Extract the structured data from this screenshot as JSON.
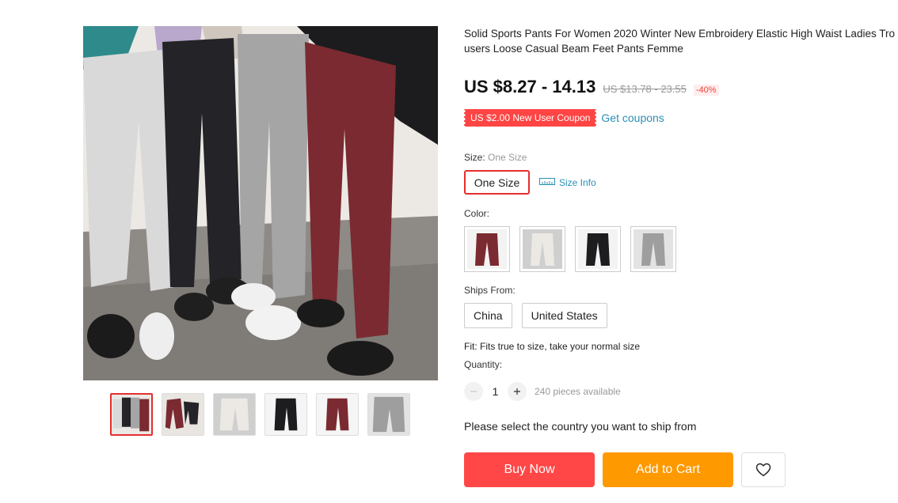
{
  "product": {
    "title": "Solid Sports Pants For Women 2020 Winter New Embroidery Elastic High Waist Ladies Trousers Loose Casual Beam Feet Pants Femme",
    "price": "US $8.27 - 14.13",
    "original_price": "US $13.78 - 23.55",
    "discount": "-40%"
  },
  "coupon": {
    "label": "US $2.00 New User Coupon",
    "link": "Get coupons"
  },
  "size": {
    "label": "Size:",
    "selected": "One Size",
    "option": "One Size",
    "info_link": "Size Info"
  },
  "color": {
    "label": "Color:",
    "swatches": [
      {
        "name": "burgundy",
        "color": "#7a2a30"
      },
      {
        "name": "white",
        "color": "#e6e3de"
      },
      {
        "name": "black",
        "color": "#1d1d1f"
      },
      {
        "name": "grey",
        "color": "#9e9e9e"
      }
    ]
  },
  "ships_from": {
    "label": "Ships From:",
    "options": [
      "China",
      "United States"
    ]
  },
  "fit": "Fit: Fits true to size, take your normal size",
  "quantity": {
    "label": "Quantity:",
    "value": "1",
    "available": "240 pieces available"
  },
  "ship_message": "Please select the country you want to ship from",
  "actions": {
    "buy_now": "Buy Now",
    "add_to_cart": "Add to Cart"
  },
  "thumbnails": [
    {
      "name": "all-colors"
    },
    {
      "name": "burgundy-and-black"
    },
    {
      "name": "white"
    },
    {
      "name": "black"
    },
    {
      "name": "burgundy"
    },
    {
      "name": "grey"
    }
  ]
}
